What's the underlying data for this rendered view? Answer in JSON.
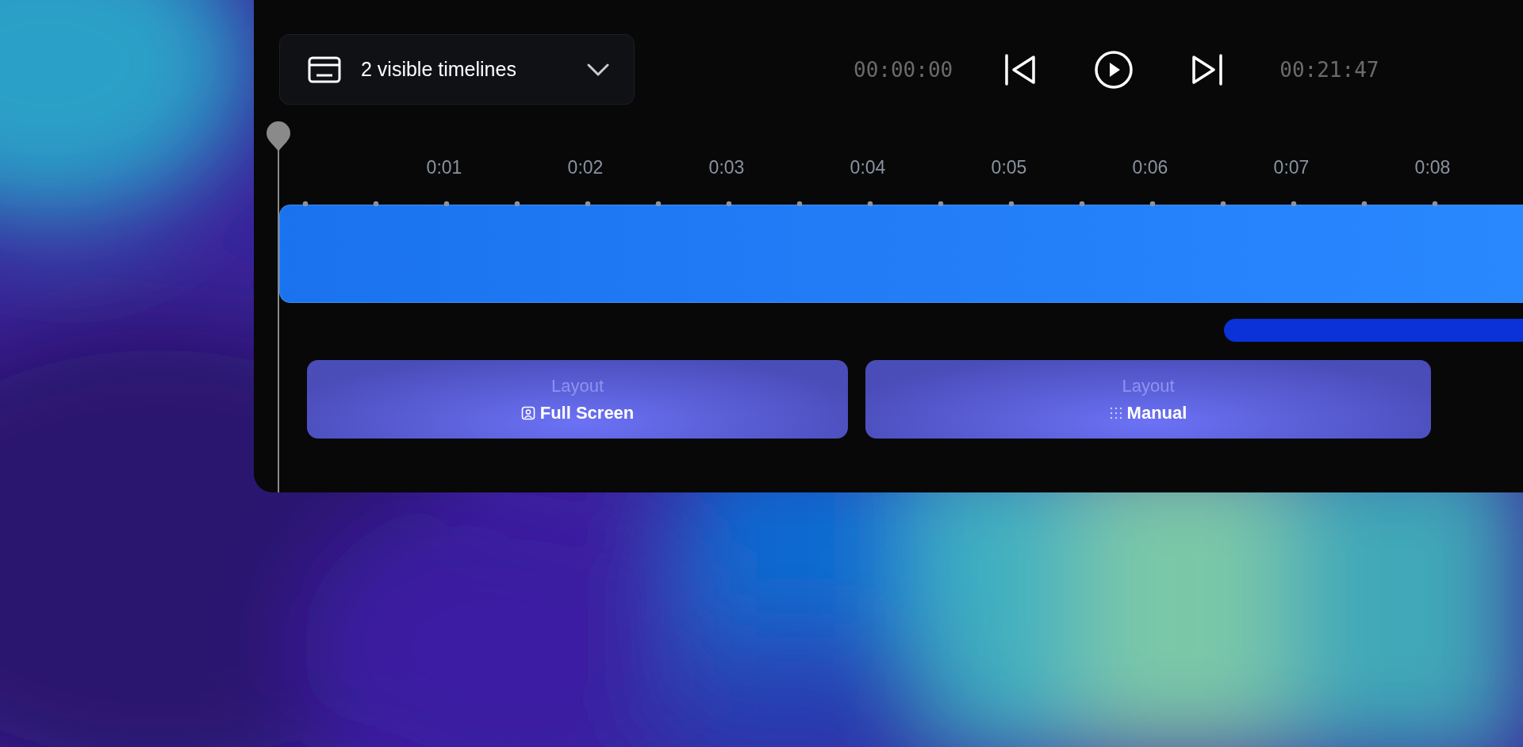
{
  "timeline_selector": {
    "label": "2 visible timelines"
  },
  "transport": {
    "start_time": "00:00:00",
    "end_time": "00:21:47"
  },
  "ruler": {
    "labels": [
      "0:01",
      "0:02",
      "0:03",
      "0:04",
      "0:05",
      "0:06",
      "0:07",
      "0:08"
    ]
  },
  "layout_clips": [
    {
      "title": "Layout",
      "label": "Full Screen",
      "kind": "full-screen"
    },
    {
      "title": "Layout",
      "label": "Manual",
      "kind": "manual"
    }
  ]
}
